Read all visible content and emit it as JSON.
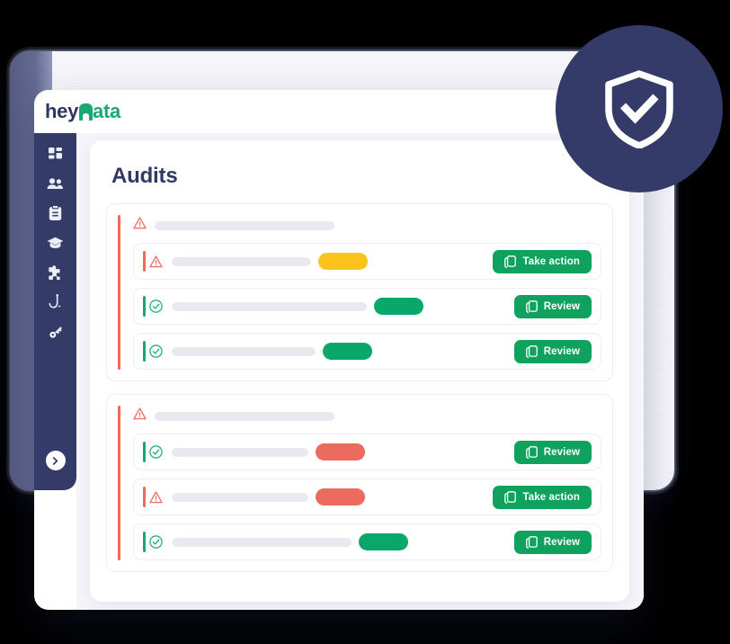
{
  "brand": {
    "logo_prefix": "hey",
    "logo_suffix": "ata",
    "logo_glyph": "D",
    "navy": "#343b69",
    "green": "#17a971",
    "red": "#ef6a5c",
    "yellow": "#fbc31b",
    "button_green": "#0fa25f"
  },
  "sidebar": {
    "items": [
      {
        "icon": "dashboard-grid-icon",
        "label": "Dashboard"
      },
      {
        "icon": "users-icon",
        "label": "Users"
      },
      {
        "icon": "clipboard-icon",
        "label": "Audits"
      },
      {
        "icon": "graduation-cap-icon",
        "label": "Training"
      },
      {
        "icon": "puzzle-piece-icon",
        "label": "Integrations"
      },
      {
        "icon": "phishing-hook-icon",
        "label": "Phishing"
      },
      {
        "icon": "key-icon",
        "label": "Access"
      }
    ],
    "expand": {
      "icon": "chevron-right-icon",
      "label": "Expand menu"
    }
  },
  "page": {
    "title": "Audits"
  },
  "badge": {
    "icon": "shield-check-icon"
  },
  "buttons": {
    "take_action": "Take action",
    "review": "Review",
    "icon": "copy-icon"
  },
  "groups": [
    {
      "status": "warning",
      "bar_color": "#ef6a5c",
      "head_icon": "warning-triangle-icon",
      "head_skeleton_width": 200,
      "rows": [
        {
          "bar_color": "#ef6a5c",
          "icon": "warning-triangle-icon",
          "skeleton_width": 155,
          "pill_color": "#fbc31b",
          "pill_width": 55,
          "action": "Take action"
        },
        {
          "bar_color": "#17a971",
          "icon": "check-circle-icon",
          "skeleton_width": 217,
          "pill_color": "#09a76a",
          "pill_width": 55,
          "action": "Review"
        },
        {
          "bar_color": "#17a971",
          "icon": "check-circle-icon",
          "skeleton_width": 160,
          "pill_color": "#09a76a",
          "pill_width": 55,
          "action": "Review"
        }
      ]
    },
    {
      "status": "warning",
      "bar_color": "#ef6a5c",
      "head_icon": "warning-triangle-icon",
      "head_skeleton_width": 200,
      "rows": [
        {
          "bar_color": "#17a971",
          "icon": "check-circle-icon",
          "skeleton_width": 152,
          "pill_color": "#ec6a5e",
          "pill_width": 55,
          "action": "Review"
        },
        {
          "bar_color": "#ef6a5c",
          "icon": "warning-triangle-icon",
          "skeleton_width": 152,
          "pill_color": "#ec6a5e",
          "pill_width": 55,
          "action": "Take action"
        },
        {
          "bar_color": "#17a971",
          "icon": "check-circle-icon",
          "skeleton_width": 200,
          "pill_color": "#09a76a",
          "pill_width": 55,
          "action": "Review"
        }
      ]
    }
  ]
}
